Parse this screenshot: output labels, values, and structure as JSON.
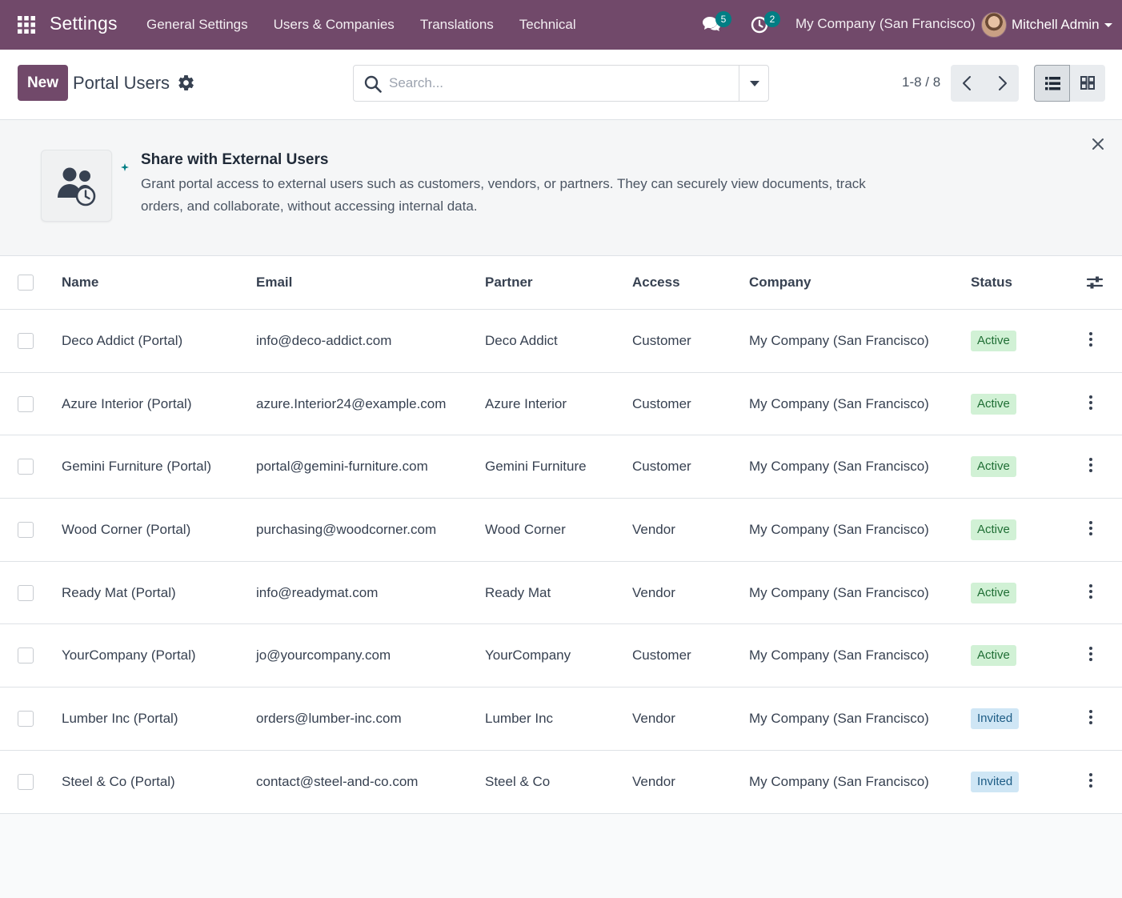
{
  "navbar": {
    "app_title": "Settings",
    "menu": [
      "General Settings",
      "Users & Companies",
      "Translations",
      "Technical"
    ],
    "messages_count": "5",
    "activities_count": "2",
    "company": "My Company (San Francisco)",
    "user_name": "Mitchell Admin",
    "color": "#71496a"
  },
  "control_panel": {
    "new_label": "New",
    "title": "Portal Users",
    "search_placeholder": "Search...",
    "pager": "1-8 / 8"
  },
  "helper": {
    "title": "Share with External Users",
    "text": "Grant portal access to external users such as customers, vendors, or partners. They can securely view documents, track orders, and collaborate, without accessing internal data."
  },
  "table": {
    "headers": {
      "name": "Name",
      "email": "Email",
      "partner": "Partner",
      "access": "Access",
      "company": "Company",
      "status": "Status"
    },
    "rows": [
      {
        "name": "Deco Addict (Portal)",
        "email": "info@deco-addict.com",
        "partner": "Deco Addict",
        "access": "Customer",
        "company": "My Company (San Francisco)",
        "status": "Active"
      },
      {
        "name": "Azure Interior (Portal)",
        "email": "azure.Interior24@example.com",
        "partner": "Azure Interior",
        "access": "Customer",
        "company": "My Company (San Francisco)",
        "status": "Active"
      },
      {
        "name": "Gemini Furniture (Portal)",
        "email": "portal@gemini-furniture.com",
        "partner": "Gemini Furniture",
        "access": "Customer",
        "company": "My Company (San Francisco)",
        "status": "Active"
      },
      {
        "name": "Wood Corner (Portal)",
        "email": "purchasing@woodcorner.com",
        "partner": "Wood Corner",
        "access": "Vendor",
        "company": "My Company (San Francisco)",
        "status": "Active"
      },
      {
        "name": "Ready Mat (Portal)",
        "email": "info@readymat.com",
        "partner": "Ready Mat",
        "access": "Vendor",
        "company": "My Company (San Francisco)",
        "status": "Active"
      },
      {
        "name": "YourCompany (Portal)",
        "email": "jo@yourcompany.com",
        "partner": "YourCompany",
        "access": "Customer",
        "company": "My Company (San Francisco)",
        "status": "Active"
      },
      {
        "name": "Lumber Inc (Portal)",
        "email": "orders@lumber-inc.com",
        "partner": "Lumber Inc",
        "access": "Vendor",
        "company": "My Company (San Francisco)",
        "status": "Invited"
      },
      {
        "name": "Steel & Co (Portal)",
        "email": "contact@steel-and-co.com",
        "partner": "Steel & Co",
        "access": "Vendor",
        "company": "My Company (San Francisco)",
        "status": "Invited"
      }
    ]
  },
  "colors": {
    "status_active": "#d1f1d5",
    "status_invited": "#cfe6f5",
    "badge_teal": "#017e84"
  }
}
